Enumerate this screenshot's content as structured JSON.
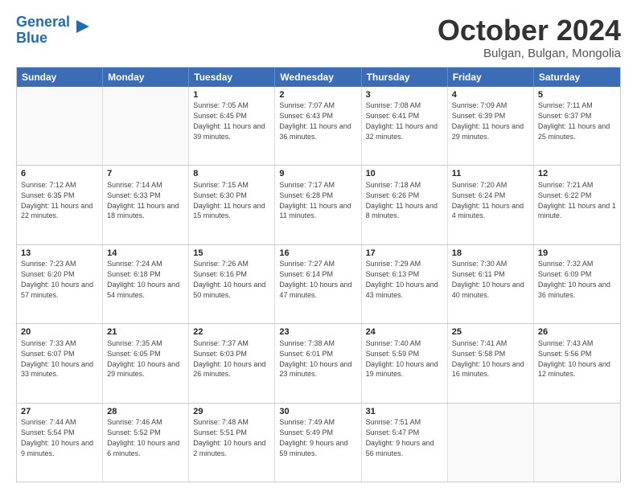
{
  "header": {
    "logo_line1": "General",
    "logo_line2": "Blue",
    "month": "October 2024",
    "location": "Bulgan, Bulgan, Mongolia"
  },
  "days_of_week": [
    "Sunday",
    "Monday",
    "Tuesday",
    "Wednesday",
    "Thursday",
    "Friday",
    "Saturday"
  ],
  "weeks": [
    [
      {
        "day": "",
        "sunrise": "",
        "sunset": "",
        "daylight": ""
      },
      {
        "day": "",
        "sunrise": "",
        "sunset": "",
        "daylight": ""
      },
      {
        "day": "1",
        "sunrise": "Sunrise: 7:05 AM",
        "sunset": "Sunset: 6:45 PM",
        "daylight": "Daylight: 11 hours and 39 minutes."
      },
      {
        "day": "2",
        "sunrise": "Sunrise: 7:07 AM",
        "sunset": "Sunset: 6:43 PM",
        "daylight": "Daylight: 11 hours and 36 minutes."
      },
      {
        "day": "3",
        "sunrise": "Sunrise: 7:08 AM",
        "sunset": "Sunset: 6:41 PM",
        "daylight": "Daylight: 11 hours and 32 minutes."
      },
      {
        "day": "4",
        "sunrise": "Sunrise: 7:09 AM",
        "sunset": "Sunset: 6:39 PM",
        "daylight": "Daylight: 11 hours and 29 minutes."
      },
      {
        "day": "5",
        "sunrise": "Sunrise: 7:11 AM",
        "sunset": "Sunset: 6:37 PM",
        "daylight": "Daylight: 11 hours and 25 minutes."
      }
    ],
    [
      {
        "day": "6",
        "sunrise": "Sunrise: 7:12 AM",
        "sunset": "Sunset: 6:35 PM",
        "daylight": "Daylight: 11 hours and 22 minutes."
      },
      {
        "day": "7",
        "sunrise": "Sunrise: 7:14 AM",
        "sunset": "Sunset: 6:33 PM",
        "daylight": "Daylight: 11 hours and 18 minutes."
      },
      {
        "day": "8",
        "sunrise": "Sunrise: 7:15 AM",
        "sunset": "Sunset: 6:30 PM",
        "daylight": "Daylight: 11 hours and 15 minutes."
      },
      {
        "day": "9",
        "sunrise": "Sunrise: 7:17 AM",
        "sunset": "Sunset: 6:28 PM",
        "daylight": "Daylight: 11 hours and 11 minutes."
      },
      {
        "day": "10",
        "sunrise": "Sunrise: 7:18 AM",
        "sunset": "Sunset: 6:26 PM",
        "daylight": "Daylight: 11 hours and 8 minutes."
      },
      {
        "day": "11",
        "sunrise": "Sunrise: 7:20 AM",
        "sunset": "Sunset: 6:24 PM",
        "daylight": "Daylight: 11 hours and 4 minutes."
      },
      {
        "day": "12",
        "sunrise": "Sunrise: 7:21 AM",
        "sunset": "Sunset: 6:22 PM",
        "daylight": "Daylight: 11 hours and 1 minute."
      }
    ],
    [
      {
        "day": "13",
        "sunrise": "Sunrise: 7:23 AM",
        "sunset": "Sunset: 6:20 PM",
        "daylight": "Daylight: 10 hours and 57 minutes."
      },
      {
        "day": "14",
        "sunrise": "Sunrise: 7:24 AM",
        "sunset": "Sunset: 6:18 PM",
        "daylight": "Daylight: 10 hours and 54 minutes."
      },
      {
        "day": "15",
        "sunrise": "Sunrise: 7:26 AM",
        "sunset": "Sunset: 6:16 PM",
        "daylight": "Daylight: 10 hours and 50 minutes."
      },
      {
        "day": "16",
        "sunrise": "Sunrise: 7:27 AM",
        "sunset": "Sunset: 6:14 PM",
        "daylight": "Daylight: 10 hours and 47 minutes."
      },
      {
        "day": "17",
        "sunrise": "Sunrise: 7:29 AM",
        "sunset": "Sunset: 6:13 PM",
        "daylight": "Daylight: 10 hours and 43 minutes."
      },
      {
        "day": "18",
        "sunrise": "Sunrise: 7:30 AM",
        "sunset": "Sunset: 6:11 PM",
        "daylight": "Daylight: 10 hours and 40 minutes."
      },
      {
        "day": "19",
        "sunrise": "Sunrise: 7:32 AM",
        "sunset": "Sunset: 6:09 PM",
        "daylight": "Daylight: 10 hours and 36 minutes."
      }
    ],
    [
      {
        "day": "20",
        "sunrise": "Sunrise: 7:33 AM",
        "sunset": "Sunset: 6:07 PM",
        "daylight": "Daylight: 10 hours and 33 minutes."
      },
      {
        "day": "21",
        "sunrise": "Sunrise: 7:35 AM",
        "sunset": "Sunset: 6:05 PM",
        "daylight": "Daylight: 10 hours and 29 minutes."
      },
      {
        "day": "22",
        "sunrise": "Sunrise: 7:37 AM",
        "sunset": "Sunset: 6:03 PM",
        "daylight": "Daylight: 10 hours and 26 minutes."
      },
      {
        "day": "23",
        "sunrise": "Sunrise: 7:38 AM",
        "sunset": "Sunset: 6:01 PM",
        "daylight": "Daylight: 10 hours and 23 minutes."
      },
      {
        "day": "24",
        "sunrise": "Sunrise: 7:40 AM",
        "sunset": "Sunset: 5:59 PM",
        "daylight": "Daylight: 10 hours and 19 minutes."
      },
      {
        "day": "25",
        "sunrise": "Sunrise: 7:41 AM",
        "sunset": "Sunset: 5:58 PM",
        "daylight": "Daylight: 10 hours and 16 minutes."
      },
      {
        "day": "26",
        "sunrise": "Sunrise: 7:43 AM",
        "sunset": "Sunset: 5:56 PM",
        "daylight": "Daylight: 10 hours and 12 minutes."
      }
    ],
    [
      {
        "day": "27",
        "sunrise": "Sunrise: 7:44 AM",
        "sunset": "Sunset: 5:54 PM",
        "daylight": "Daylight: 10 hours and 9 minutes."
      },
      {
        "day": "28",
        "sunrise": "Sunrise: 7:46 AM",
        "sunset": "Sunset: 5:52 PM",
        "daylight": "Daylight: 10 hours and 6 minutes."
      },
      {
        "day": "29",
        "sunrise": "Sunrise: 7:48 AM",
        "sunset": "Sunset: 5:51 PM",
        "daylight": "Daylight: 10 hours and 2 minutes."
      },
      {
        "day": "30",
        "sunrise": "Sunrise: 7:49 AM",
        "sunset": "Sunset: 5:49 PM",
        "daylight": "Daylight: 9 hours and 59 minutes."
      },
      {
        "day": "31",
        "sunrise": "Sunrise: 7:51 AM",
        "sunset": "Sunset: 5:47 PM",
        "daylight": "Daylight: 9 hours and 56 minutes."
      },
      {
        "day": "",
        "sunrise": "",
        "sunset": "",
        "daylight": ""
      },
      {
        "day": "",
        "sunrise": "",
        "sunset": "",
        "daylight": ""
      }
    ]
  ]
}
